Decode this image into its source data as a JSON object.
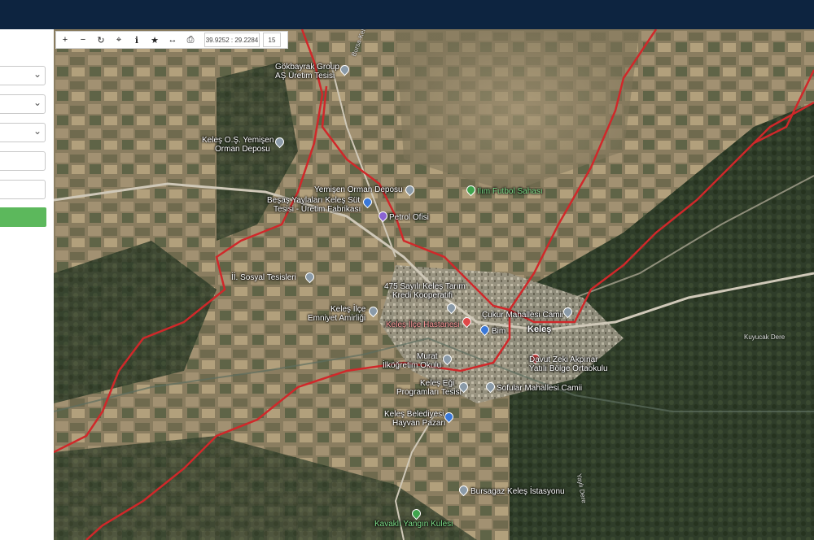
{
  "toolbar": {
    "zoom_in": "+",
    "zoom_out": "−",
    "refresh": "↻",
    "locate": "⌖",
    "info": "ℹ",
    "favorite": "★",
    "measure": "↔",
    "print": "⎙",
    "coordinates": "39.9252 : 29.2284",
    "zoom_level": "15"
  },
  "labels": {
    "gokbayrak": "Gökbayrak Group",
    "gokbayrak2": "AŞ Üretim Tesisi",
    "yemisen_depo1": "Keleş O.Ş. Yemişen",
    "yemisen_depo2": "Orman Deposu",
    "yemisen_orman": "Yemişen Orman Deposu",
    "besas1": "Beşaş Yaylaları Keleş Süt",
    "besas2": "Tesisi - Üretim Fabrikası",
    "petrol": "Petrol Ofisi",
    "futbol": "Ilım Futbol Sahası",
    "sosyal": "İİ. Sosyal Tesisleri",
    "kredi1": "475 Sayılı Keleş Tarım",
    "kredi2": "Kredi Kooperatifi",
    "emniyet1": "Keleş İlçe",
    "emniyet2": "Emniyet Amirliği",
    "cukur": "Çukur Mahallesi Camii",
    "hastane": "Keleş İlçe Hastanesi",
    "bim": "Bim",
    "keles": "Keleş",
    "davut1": "Davut Zeki Akpınar",
    "davut2": "Yatılı Bölge Ortaokulu",
    "murat1": "Murat",
    "murat2": "İlköğretim Okulu",
    "sofular": "Sofular Mahallesi Camii",
    "egitim1": "Keleş Eği",
    "egitim2": "Programları Tesisi",
    "belediye1": "Keleş Belediyesi",
    "belediye2": "Hayvan Pazarı",
    "bursagaz": "Bursagaz Keleş İstasyonu",
    "yangin": "Kavaklı Yangın Kulesi",
    "koydere": "Kuyucak Dere",
    "road1": "Bursa-Keleş",
    "road2": "Yaylı Dere"
  },
  "colors": {
    "boundary": "#d0282a",
    "topbar": "#0d2440",
    "button_green": "#5cb85c"
  }
}
